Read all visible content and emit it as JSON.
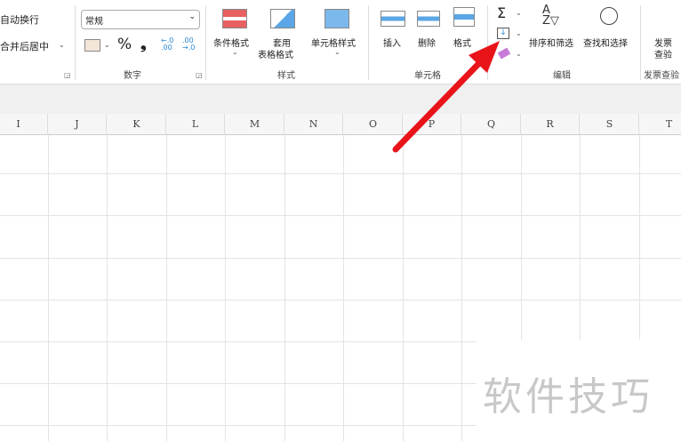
{
  "alignment": {
    "wrap_text": "自动换行",
    "merge_center": "合并后居中"
  },
  "number": {
    "format_value": "常规",
    "group_label": "数字",
    "percent": "%",
    "comma": "❟",
    "inc_decimal": "←.0\n.00",
    "dec_decimal": ".00\n→.0"
  },
  "styles": {
    "conditional": "条件格式",
    "table_format_1": "套用",
    "table_format_2": "表格格式",
    "cell_styles": "单元格样式",
    "group_label": "样式"
  },
  "cells": {
    "insert": "插入",
    "delete": "删除",
    "format": "格式",
    "group_label": "单元格"
  },
  "editing": {
    "sum": "Σ",
    "sort_filter": "排序和筛选",
    "find_select": "查找和选择",
    "group_label": "编辑"
  },
  "invoice": {
    "check_1": "发票",
    "check_2": "查验",
    "group_label": "发票查验"
  },
  "columns": [
    "I",
    "J",
    "K",
    "L",
    "M",
    "N",
    "O",
    "P",
    "Q",
    "R",
    "S",
    "T"
  ],
  "watermark": "软件技巧",
  "colors": {
    "arrow": "#e8141a"
  }
}
